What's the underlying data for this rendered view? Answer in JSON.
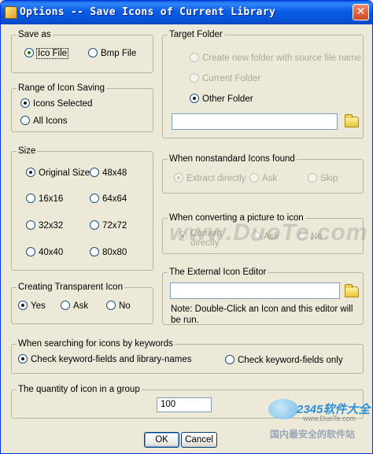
{
  "window": {
    "title": "Options -- Save Icons of Current Library",
    "close_glyph": "✕"
  },
  "save_as": {
    "title": "Save as",
    "options": [
      {
        "label": "Ico File",
        "selected": true
      },
      {
        "label": "Bmp File",
        "selected": false
      }
    ]
  },
  "range": {
    "title": "Range of Icon Saving",
    "options": [
      {
        "label": "Icons Selected",
        "selected": true
      },
      {
        "label": "All Icons",
        "selected": false
      }
    ]
  },
  "size": {
    "title": "Size",
    "options": [
      {
        "label": "Original Size",
        "selected": true
      },
      {
        "label": "48x48",
        "selected": false
      },
      {
        "label": "16x16",
        "selected": false
      },
      {
        "label": "64x64",
        "selected": false
      },
      {
        "label": "32x32",
        "selected": false
      },
      {
        "label": "72x72",
        "selected": false
      },
      {
        "label": "40x40",
        "selected": false
      },
      {
        "label": "80x80",
        "selected": false
      }
    ]
  },
  "transparent": {
    "title": "Creating Transparent Icon",
    "options": [
      {
        "label": "Yes",
        "selected": true
      },
      {
        "label": "Ask",
        "selected": false
      },
      {
        "label": "No",
        "selected": false
      }
    ]
  },
  "target_folder": {
    "title": "Target Folder",
    "options": [
      {
        "label": "Create new folder with source file name",
        "enabled": false,
        "selected": false
      },
      {
        "label": "Current Folder",
        "enabled": false,
        "selected": false
      },
      {
        "label": "Other Folder",
        "enabled": true,
        "selected": true
      }
    ],
    "path_value": "",
    "browse_icon": "folder-icon"
  },
  "nonstandard": {
    "title": "When nonstandard Icons found",
    "options": [
      {
        "label": "Extract directly",
        "selected": true
      },
      {
        "label": "Ask",
        "selected": false
      },
      {
        "label": "Skip",
        "selected": false
      }
    ]
  },
  "converting": {
    "title": "When converting a picture to icon",
    "options": [
      {
        "label": "Convert directly",
        "selected": true
      },
      {
        "label": "Ask",
        "selected": false
      },
      {
        "label": "No",
        "selected": false
      }
    ]
  },
  "editor": {
    "title": "The External Icon Editor",
    "path_value": "",
    "browse_icon": "folder-icon",
    "note": "Note: Double-Click an Icon and this editor will be run."
  },
  "keyword_search": {
    "title": "When searching for icons by keywords",
    "options": [
      {
        "label": "Check keyword-fields and library-names",
        "selected": true
      },
      {
        "label": "Check keyword-fields only",
        "selected": false
      }
    ]
  },
  "group_quantity": {
    "title": "The quantity of icon in a group",
    "value": "100"
  },
  "buttons": {
    "ok": "OK",
    "cancel": "Cancel"
  },
  "watermarks": {
    "center": "www.DuoTe.com",
    "logo_number": "2345软件大全",
    "logo_site": "www.DuoTe.com",
    "logo_slogan": "国内最安全的软件站"
  },
  "colors": {
    "title_bar": "#0a5be6",
    "dialog_bg": "#ece9d8",
    "group_border": "#b8b49e",
    "radio_dot": "#1f7a1f"
  }
}
